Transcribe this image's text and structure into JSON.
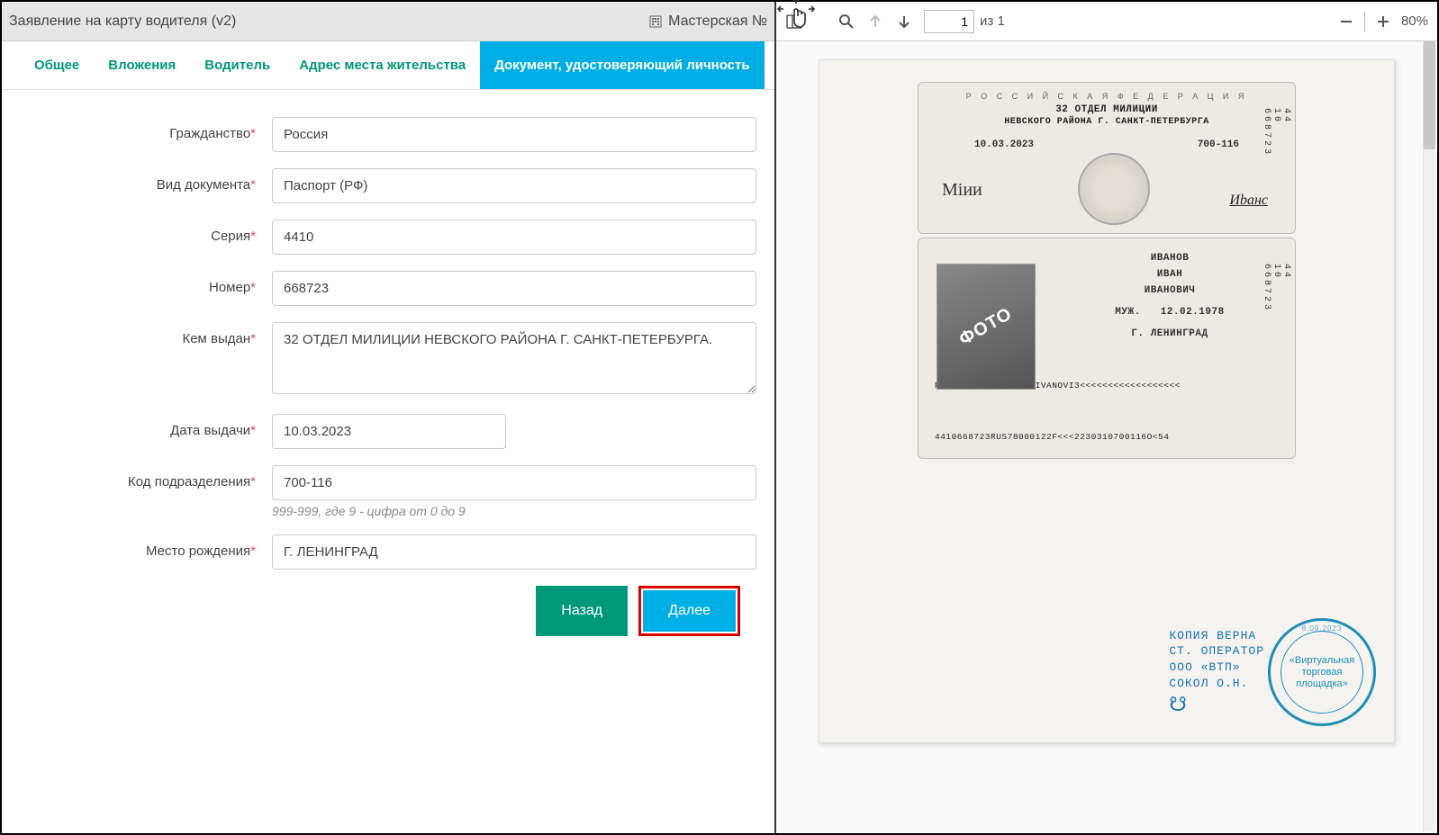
{
  "header": {
    "title": "Заявление на карту водителя (v2)",
    "workshop_label": "Мастерская №"
  },
  "tabs": {
    "general": "Общее",
    "attachments": "Вложения",
    "driver": "Водитель",
    "address": "Адрес места жительства",
    "identity_doc": "Документ, удостоверяющий личность"
  },
  "form": {
    "labels": {
      "citizenship": "Гражданство",
      "doc_type": "Вид документа",
      "series": "Серия",
      "number": "Номер",
      "issued_by": "Кем выдан",
      "issue_date": "Дата выдачи",
      "dept_code": "Код подразделения",
      "birth_place": "Место рождения"
    },
    "values": {
      "citizenship": "Россия",
      "doc_type": "Паспорт (РФ)",
      "series": "4410",
      "number": "668723",
      "issued_by": "32 ОТДЕЛ МИЛИЦИИ НЕВСКОГО РАЙОНА Г. САНКТ-ПЕТЕРБУРГА.",
      "issue_date": "10.03.2023",
      "dept_code": "700-116",
      "birth_place": "Г. ЛЕНИНГРАД"
    },
    "dept_code_hint": "999-999, где 9 - цифра от 0 до 9"
  },
  "buttons": {
    "back": "Назад",
    "next": "Далее"
  },
  "pdf_viewer": {
    "page_current": "1",
    "page_of_label": "из",
    "page_total": "1",
    "zoom": "80%"
  },
  "passport": {
    "rf_title": "Р О С С И Й С К А Я   Ф Е Д Е Р А Ц И Я",
    "dept": "32 ОТДЕЛ МИЛИЦИИ",
    "dept2": "НЕВСКОГО РАЙОНА Г. САНКТ-ПЕТЕРБУРГА",
    "issue_date": "10.03.2023",
    "code": "700-116",
    "side_a": "44",
    "side_b": "10",
    "side_c": "668723",
    "photo_label": "ФОТО",
    "surname": "ИВАНОВ",
    "name": "ИВАН",
    "patronymic": "ИВАНОВИЧ",
    "sex": "МУЖ.",
    "dob": "12.02.1978",
    "pob": "Г. ЛЕНИНГРАД",
    "mrz1": "PNRUSIVANOV<<IVAN<IVANOVI3<<<<<<<<<<<<<<<<<<",
    "mrz2": "4410668723RUS78000122F<<<2230310700116O<54",
    "sig1": "Miии",
    "sig2": "Иbанс"
  },
  "stamp": {
    "line1": "КОПИЯ  ВЕРНА",
    "line2": "СТ. ОПЕРАТОР",
    "line3": "ООО  «ВТП»",
    "line4": "СОКОЛ О.Н.",
    "round_date": "8.09.2023",
    "round1": "«Виртуальная",
    "round2": "торговая",
    "round3": "площадка»"
  }
}
